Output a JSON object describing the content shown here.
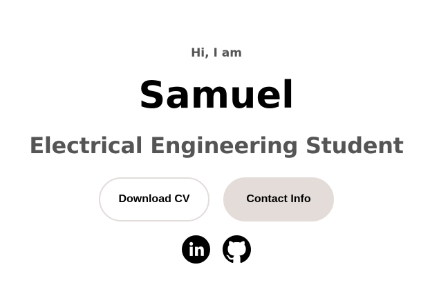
{
  "hero": {
    "greeting": "Hi, I am",
    "name": "Samuel",
    "role": "Electrical Engineering Student"
  },
  "buttons": {
    "download_cv": "Download CV",
    "contact_info": "Contact Info"
  },
  "social": {
    "linkedin_icon": "linkedin-icon",
    "github_icon": "github-icon"
  },
  "colors": {
    "accent_button_bg": "#e3dcd9",
    "button_border": "#e2dcda",
    "text_primary": "#000000",
    "text_secondary": "#555555"
  }
}
